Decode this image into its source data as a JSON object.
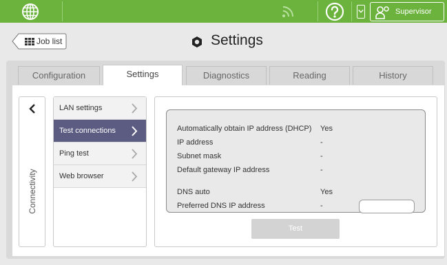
{
  "topbar": {
    "colors": {
      "bar": "#6cb33e",
      "divider": "#9ad07a"
    },
    "globe_icon": "globe-icon",
    "feed_icon": "feed-icon",
    "help_icon": "help-icon",
    "user": {
      "icon": "user-icon",
      "label": "Supervisor"
    }
  },
  "header": {
    "job_list_label": "Job list",
    "title": "Settings"
  },
  "tabs": [
    {
      "label": "Configuration",
      "active": false
    },
    {
      "label": "Settings",
      "active": true
    },
    {
      "label": "Diagnostics",
      "active": false
    },
    {
      "label": "Reading",
      "active": false
    },
    {
      "label": "History",
      "active": false
    }
  ],
  "sidebar": {
    "label": "Connectivity"
  },
  "menu": {
    "items": [
      {
        "label": "LAN settings",
        "active": false
      },
      {
        "label": "Test connections",
        "active": true
      },
      {
        "label": "Ping test",
        "active": false
      },
      {
        "label": "Web browser",
        "active": false
      }
    ],
    "active_color": "#5c5c82"
  },
  "connection": {
    "rows": [
      {
        "label": "Automatically obtain IP address (DHCP)",
        "value": "Yes"
      },
      {
        "label": "IP address",
        "value": "-"
      },
      {
        "label": "Subnet mask",
        "value": "-"
      },
      {
        "label": "Default gateway IP address",
        "value": "-"
      },
      {
        "label": "DNS auto",
        "value": "Yes"
      },
      {
        "label": "Preferred DNS IP address",
        "value": "-"
      }
    ],
    "dns_input_value": ""
  },
  "actions": {
    "test_label": "Test"
  }
}
